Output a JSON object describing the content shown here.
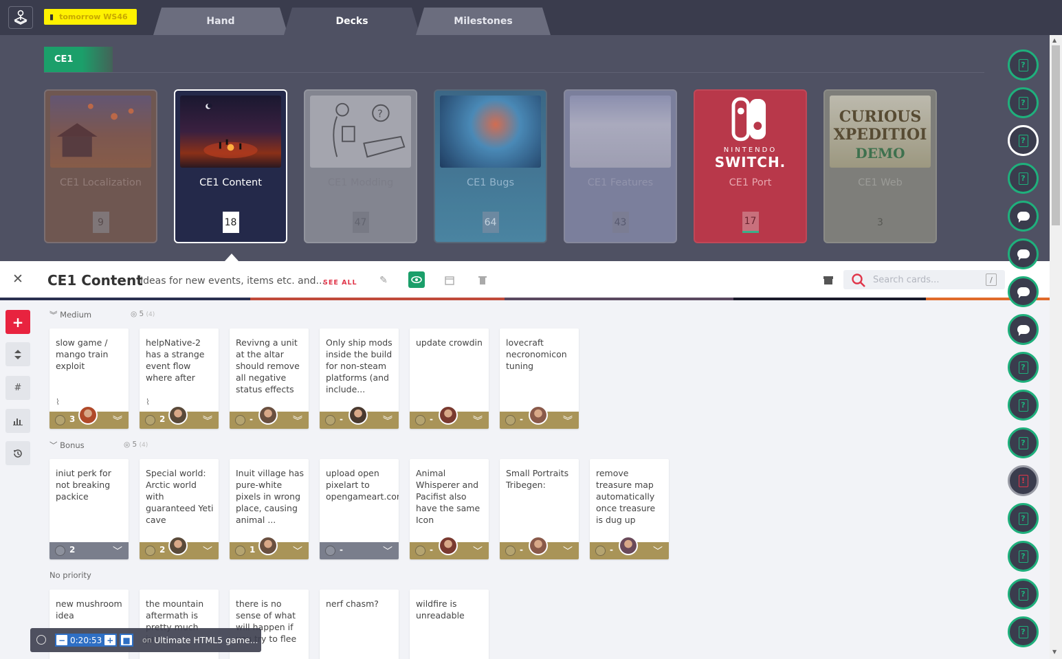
{
  "topbar": {
    "workspace_badge": "tomorrow WS46",
    "tabs": [
      {
        "label": "Hand",
        "active": false
      },
      {
        "label": "Decks",
        "active": true
      },
      {
        "label": "Milestones",
        "active": false
      }
    ]
  },
  "project": {
    "label": "CE1"
  },
  "decks": [
    {
      "name": "CE1 Localization",
      "count": "9",
      "selected": false
    },
    {
      "name": "CE1 Content",
      "count": "18",
      "selected": true
    },
    {
      "name": "CE1 Modding",
      "count": "47",
      "selected": false
    },
    {
      "name": "CE1 Bugs",
      "count": "64",
      "selected": false
    },
    {
      "name": "CE1 Features",
      "count": "43",
      "selected": false
    },
    {
      "name": "CE1 Port",
      "count": "17",
      "selected": false
    },
    {
      "name": "CE1 Web",
      "count": "3",
      "selected": false
    }
  ],
  "deck_art_text": {
    "port_brand_top": "NINTENDO",
    "port_brand_bottom": "SWITCH.",
    "web_line1": "CURIOUS",
    "web_line2": "XPEDITIOI",
    "web_line3": "DEMO"
  },
  "panel": {
    "title": "CE1 Content",
    "description": "Ideas for new events, items etc. and...",
    "see_all": "SEE ALL",
    "search_placeholder": "Search cards...",
    "search_shortcut": "/"
  },
  "groups": [
    {
      "label": "Medium",
      "count": "5",
      "sub": "(4)",
      "cards": [
        {
          "text": "slow game / mango train exploit",
          "effort": "3",
          "footer": "gold",
          "attachment": true
        },
        {
          "text": "helpNative-2 has a strange event flow where after",
          "effort": "2",
          "footer": "gold",
          "attachment": true
        },
        {
          "text": "Revivng a unit at the altar should remove all negative status effects",
          "effort": "-",
          "footer": "gold",
          "attachment": false
        },
        {
          "text": "Only ship mods inside the build for non-steam platforms (and include...",
          "effort": "-",
          "footer": "gold",
          "attachment": false
        },
        {
          "text": "update crowdin",
          "effort": "-",
          "footer": "gold",
          "attachment": false
        },
        {
          "text": "lovecraft necronomicon tuning",
          "effort": "-",
          "footer": "gold",
          "attachment": false
        }
      ]
    },
    {
      "label": "Bonus",
      "count": "5",
      "sub": "(4)",
      "cards": [
        {
          "text": "iniut perk for not breaking packice",
          "effort": "2",
          "footer": "gray",
          "attachment": false
        },
        {
          "text": "Special world: Arctic world with guaranteed Yeti cave",
          "effort": "2",
          "footer": "gold",
          "attachment": false
        },
        {
          "text": "Inuit village has pure-white pixels in wrong place, causing animal ...",
          "effort": "1",
          "footer": "gold",
          "attachment": false
        },
        {
          "text": "upload open pixelart to opengameart.com?",
          "effort": "-",
          "footer": "gray",
          "attachment": false
        },
        {
          "text": "Animal Whisperer and Pacifist also have the same Icon",
          "effort": "-",
          "footer": "gold",
          "attachment": false
        },
        {
          "text": "Small Portraits Tribegen:",
          "effort": "-",
          "footer": "gold",
          "attachment": false
        },
        {
          "text": "remove treasure map automatically once treasure is dug up",
          "effort": "-",
          "footer": "gold",
          "attachment": false
        }
      ]
    },
    {
      "label": "No priority",
      "count": "",
      "sub": "",
      "cards": [
        {
          "text": "new mushroom idea",
          "effort": "",
          "footer": "none",
          "attachment": false
        },
        {
          "text": "the mountain aftermath is pretty much just",
          "effort": "",
          "footer": "none",
          "attachment": false
        },
        {
          "text": "there is no sense of what will happen if you try to flee",
          "effort": "",
          "footer": "none",
          "attachment": false
        },
        {
          "text": "nerf chasm?",
          "effort": "",
          "footer": "none",
          "attachment": false
        },
        {
          "text": "wildfire is unreadable",
          "effort": "",
          "footer": "none",
          "attachment": false
        }
      ]
    }
  ],
  "timer": {
    "time": "0:20:53",
    "on_label": "on",
    "task": "Ultimate HTML5 game..."
  },
  "right_sidebar": [
    {
      "icon": "question-card-icon",
      "ring": "green"
    },
    {
      "icon": "question-card-icon",
      "ring": "green"
    },
    {
      "icon": "question-card-icon",
      "ring": "white"
    },
    {
      "icon": "question-card-icon",
      "ring": "green"
    },
    {
      "icon": "chat-bubble-icon",
      "ring": "green"
    },
    {
      "icon": "chat-bubble-icon",
      "ring": "green"
    },
    {
      "icon": "chat-bubble-icon",
      "ring": "green"
    },
    {
      "icon": "chat-bubble-icon",
      "ring": "green"
    },
    {
      "icon": "question-card-icon",
      "ring": "green"
    },
    {
      "icon": "question-card-icon",
      "ring": "green"
    },
    {
      "icon": "question-card-icon",
      "ring": "green"
    },
    {
      "icon": "alert-card-icon",
      "ring": "gray"
    },
    {
      "icon": "question-card-icon",
      "ring": "green"
    },
    {
      "icon": "question-card-icon",
      "ring": "green"
    },
    {
      "icon": "question-card-icon",
      "ring": "green"
    },
    {
      "icon": "question-card-icon",
      "ring": "green"
    }
  ],
  "colors": {
    "accent_green": "#1b9f6a",
    "accent_red": "#e8233f",
    "topbar": "#3a3c4d",
    "decks_bg": "#4f5163",
    "card_footer_gold": "#a99458",
    "card_footer_gray": "#7a7e8c"
  }
}
